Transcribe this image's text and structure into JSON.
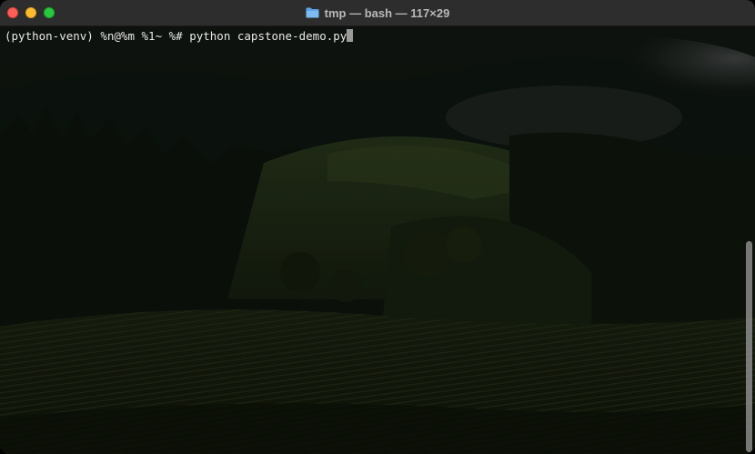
{
  "window": {
    "title": "tmp — bash — 117×29"
  },
  "terminal": {
    "prompt": "(python-venv) %n@%m %1~ %# ",
    "command": "python capstone-demo.py"
  },
  "icons": {
    "title_icon": "folder-icon"
  },
  "colors": {
    "titlebar_bg": "#2d2d2d",
    "close": "#fe5f57",
    "minimize": "#febc2e",
    "maximize": "#28c840",
    "terminal_text": "#e8e8e8"
  }
}
